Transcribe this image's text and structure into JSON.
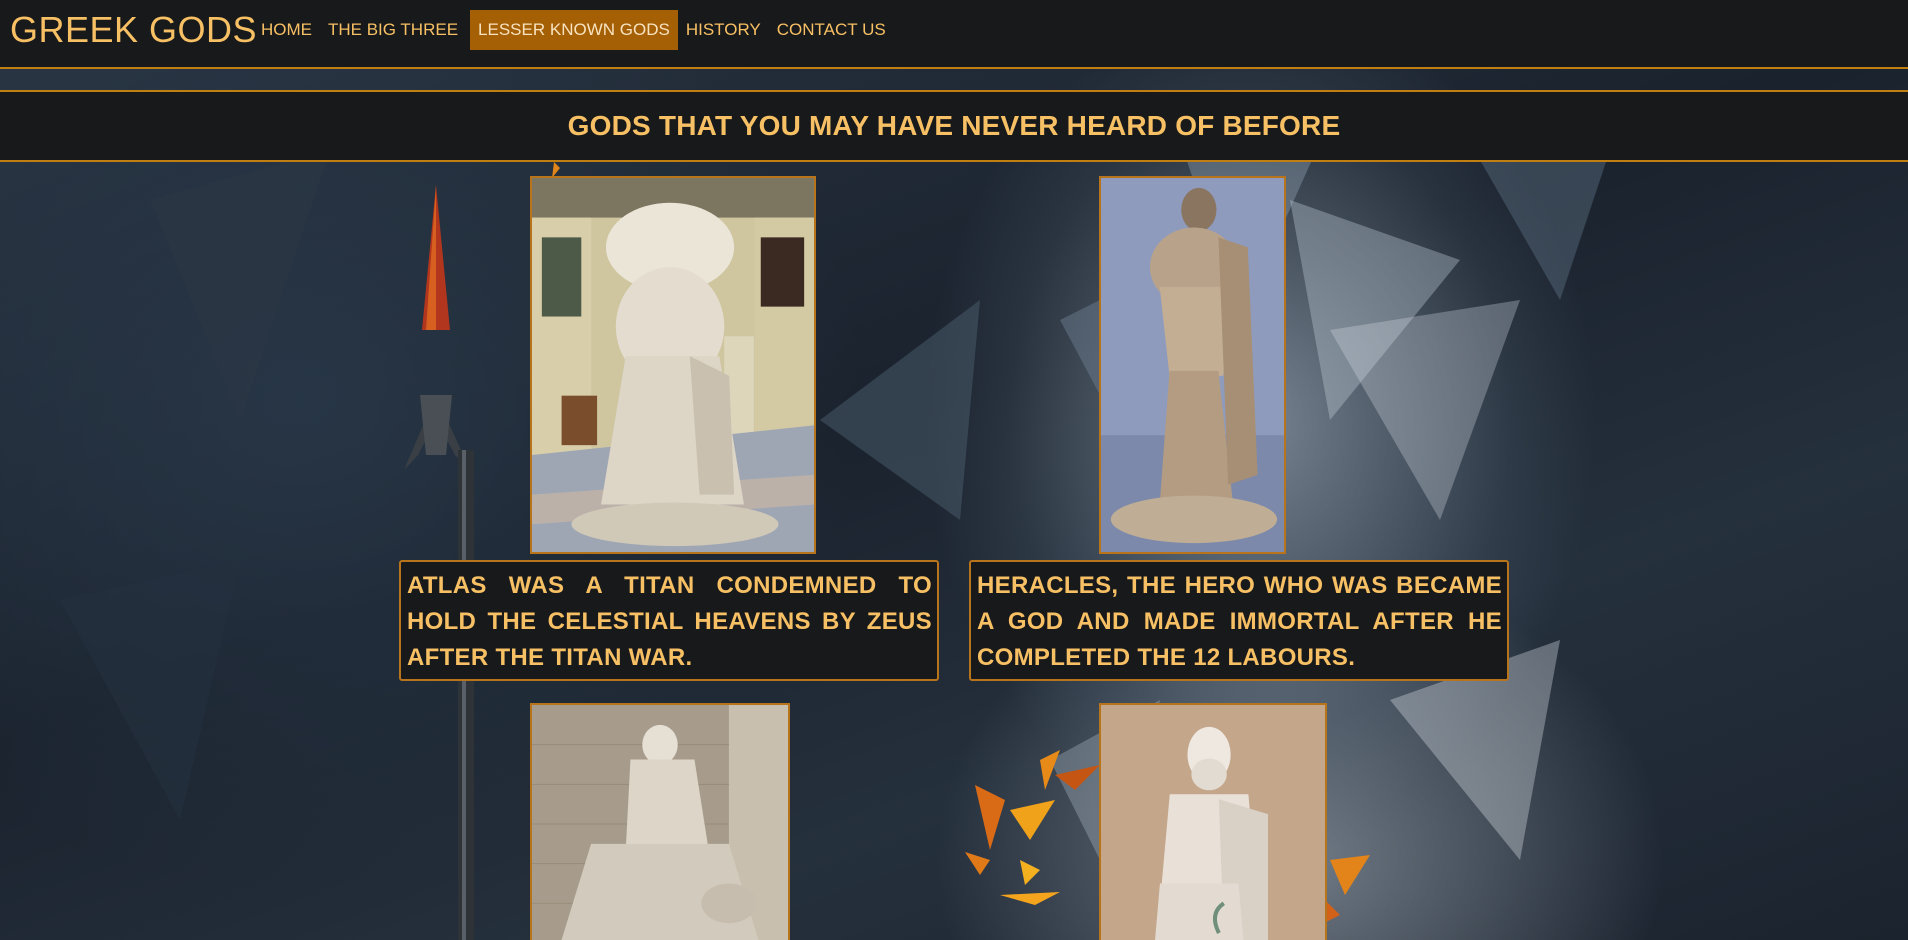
{
  "brand": "GREEK GODS",
  "nav": {
    "items": [
      {
        "label": "HOME",
        "active": false
      },
      {
        "label": "THE BIG THREE",
        "active": false
      },
      {
        "label": "LESSER KNOWN GODS",
        "active": true
      },
      {
        "label": "HISTORY",
        "active": false
      },
      {
        "label": "CONTACT US",
        "active": false
      }
    ]
  },
  "banner": {
    "title": "GODS THAT YOU MAY HAVE NEVER HEARD OF BEFORE"
  },
  "gods": [
    {
      "caption": "ATLAS WAS A TITAN CONDEMNED TO HOLD THE CELESTIAL HEAVENS BY ZEUS AFTER THE TITAN WAR.",
      "image": "atlas-statue"
    },
    {
      "caption": "HERACLES, THE HERO WHO WAS BECAME A GOD AND MADE IMMORTAL AFTER HE COMPLETED THE 12 LABOURS.",
      "image": "heracles-statue"
    },
    {
      "caption": "",
      "image": "female-statue"
    },
    {
      "caption": "",
      "image": "bearded-god-statue"
    }
  ],
  "colors": {
    "accent": "#f7c064",
    "border": "#c17f12",
    "active_nav": "#a55f05",
    "panel": "#18191b"
  }
}
